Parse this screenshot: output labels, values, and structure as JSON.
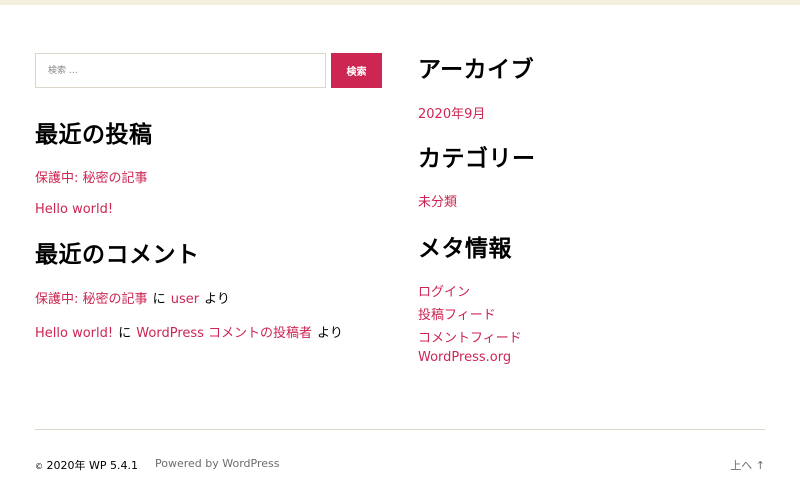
{
  "search": {
    "placeholder": "検索 …",
    "button_label": "検索"
  },
  "recent_posts": {
    "title": "最近の投稿",
    "items": [
      "保護中: 秘密の記事",
      "Hello world!"
    ]
  },
  "recent_comments": {
    "title": "最近のコメント",
    "items": [
      {
        "post": "保護中: 秘密の記事",
        "on": "に",
        "author": "user",
        "by": "より"
      },
      {
        "post": "Hello world!",
        "on": "に",
        "author": "WordPress コメントの投稿者",
        "by": "より"
      }
    ]
  },
  "archives": {
    "title": "アーカイブ",
    "items": [
      "2020年9月"
    ]
  },
  "categories": {
    "title": "カテゴリー",
    "items": [
      "未分類"
    ]
  },
  "meta": {
    "title": "メタ情報",
    "items": [
      "ログイン",
      "投稿フィード",
      "コメントフィード",
      "WordPress.org"
    ]
  },
  "footer": {
    "copyright_symbol": "©",
    "copyright_text": "2020年 WP 5.4.1",
    "powered_by": "Powered by WordPress",
    "to_top": "上へ ↑"
  },
  "colors": {
    "accent": "#cd2653",
    "border": "#dcd7ca",
    "topbar": "#f5efe0",
    "muted": "#6d6d6d"
  }
}
